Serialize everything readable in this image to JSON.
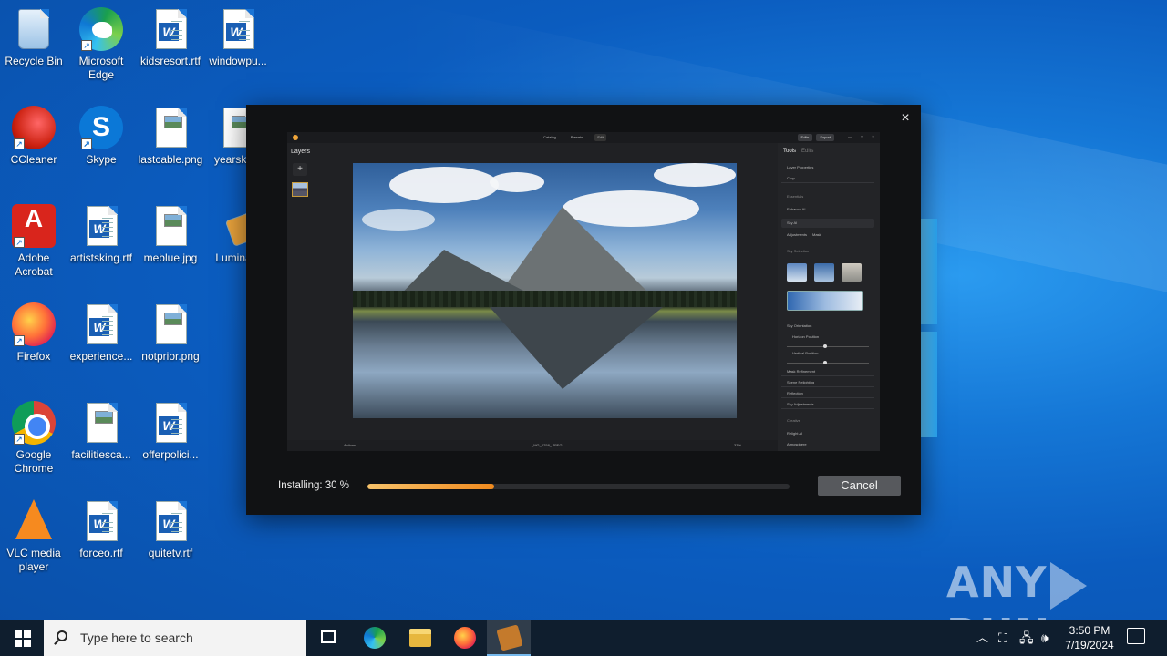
{
  "desktop": {
    "icons": [
      {
        "label": "Recycle Bin",
        "icon": "recycle-bin-icon"
      },
      {
        "label": "Microsoft Edge",
        "icon": "edge-icon"
      },
      {
        "label": "kidsresort.rtf",
        "icon": "word-document-icon"
      },
      {
        "label": "windowpu...",
        "icon": "word-document-icon"
      },
      {
        "label": "CCleaner",
        "icon": "ccleaner-icon"
      },
      {
        "label": "Skype",
        "icon": "skype-icon"
      },
      {
        "label": "lastcable.png",
        "icon": "image-file-icon"
      },
      {
        "label": "yearskb...",
        "icon": "image-file-icon"
      },
      {
        "label": "Adobe Acrobat",
        "icon": "acrobat-icon"
      },
      {
        "label": "artistsking.rtf",
        "icon": "word-document-icon"
      },
      {
        "label": "meblue.jpg",
        "icon": "image-file-icon"
      },
      {
        "label": "Lumina...",
        "icon": "luminar-installer-icon"
      },
      {
        "label": "Firefox",
        "icon": "firefox-icon"
      },
      {
        "label": "experience...",
        "icon": "word-document-icon"
      },
      {
        "label": "notprior.png",
        "icon": "image-file-icon"
      },
      {
        "label": "Google Chrome",
        "icon": "chrome-icon"
      },
      {
        "label": "facilitiesca...",
        "icon": "image-file-icon"
      },
      {
        "label": "offerpolici...",
        "icon": "word-document-icon"
      },
      {
        "label": "VLC media player",
        "icon": "vlc-icon"
      },
      {
        "label": "forceo.rtf",
        "icon": "word-document-icon"
      },
      {
        "label": "quitetv.rtf",
        "icon": "word-document-icon"
      }
    ]
  },
  "installer": {
    "close_glyph": "×",
    "status_label": "Installing: 30 %",
    "progress": 0.3,
    "cancel_label": "Cancel",
    "preview": {
      "top_tabs": [
        "Catalog",
        "Presets",
        "Edit"
      ],
      "top_right": [
        "Edits",
        "Export"
      ],
      "layers_title": "Layers",
      "add_glyph": "+",
      "panel_tabs": [
        "Tools",
        "Edits"
      ],
      "panel_rows": [
        "Layer Properties",
        "Crop",
        "Essentials",
        "Enhance AI",
        "Sky AI",
        "Adjustments",
        "Mask",
        "Sky Selection",
        "Sky Orientation",
        "Horizon Position",
        "Vertical Position",
        "Mask Refinement",
        "Scene Relighting",
        "Reflection",
        "Sky Adjustments",
        "Creative",
        "Relight AI",
        "Atmosphere"
      ],
      "bottom_left": "Actions",
      "bottom_center": "_MG_0258_.JPEG",
      "bottom_right": "33%"
    }
  },
  "watermark": {
    "left": "ANY",
    "right": "RUN"
  },
  "taskbar": {
    "search_placeholder": "Type here to search",
    "time": "3:50 PM",
    "date": "7/19/2024",
    "accent": "#76b9ed"
  }
}
